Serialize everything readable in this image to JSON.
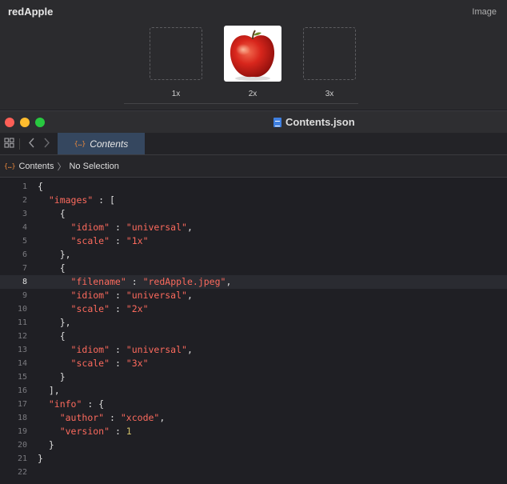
{
  "asset": {
    "name": "redApple",
    "type_label": "Image",
    "slots": [
      {
        "label": "1x",
        "filled": false
      },
      {
        "label": "2x",
        "filled": true
      },
      {
        "label": "3x",
        "filled": false
      }
    ]
  },
  "window": {
    "title": "Contents.json",
    "colors": {
      "close": "#fe5f57",
      "minimize": "#febc2e",
      "zoom": "#28c840"
    }
  },
  "tabbar": {
    "active_tab": {
      "icon": "{…}",
      "label": "Contents"
    }
  },
  "jumpbar": {
    "icon": "{…}",
    "file": "Contents",
    "selection": "No Selection"
  },
  "editor": {
    "current_line": 8,
    "lines": [
      "{",
      "  \"images\" : [",
      "    {",
      "      \"idiom\" : \"universal\",",
      "      \"scale\" : \"1x\"",
      "    },",
      "    {",
      "      \"filename\" : \"redApple.jpeg\",",
      "      \"idiom\" : \"universal\",",
      "      \"scale\" : \"2x\"",
      "    },",
      "    {",
      "      \"idiom\" : \"universal\",",
      "      \"scale\" : \"3x\"",
      "    }",
      "  ],",
      "  \"info\" : {",
      "    \"author\" : \"xcode\",",
      "    \"version\" : 1",
      "  }",
      "}",
      ""
    ]
  }
}
